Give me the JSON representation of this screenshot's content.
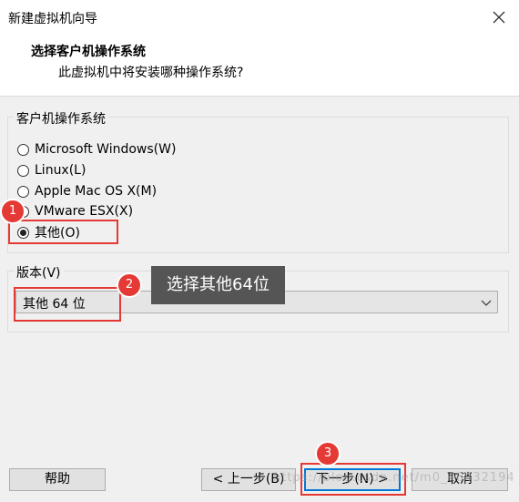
{
  "window": {
    "title": "新建虚拟机向导"
  },
  "header": {
    "title": "选择客户机操作系统",
    "subtitle": "此虚拟机中将安装哪种操作系统?"
  },
  "os_group": {
    "legend": "客户机操作系统",
    "options": [
      {
        "label": "Microsoft Windows(W)",
        "checked": false
      },
      {
        "label": "Linux(L)",
        "checked": false
      },
      {
        "label": "Apple Mac OS X(M)",
        "checked": false
      },
      {
        "label": "VMware ESX(X)",
        "checked": false
      },
      {
        "label": "其他(O)",
        "checked": true
      }
    ]
  },
  "version_group": {
    "legend": "版本(V)",
    "selected": "其他 64 位"
  },
  "annotations": {
    "badges": [
      "1",
      "2",
      "3"
    ],
    "callout": "选择其他64位",
    "highlight_color": "#e53935"
  },
  "buttons": {
    "help": "帮助",
    "back": "< 上一步(B)",
    "next": "下一步(N) >",
    "cancel": "取消"
  },
  "watermark": "https://blog.csdn.net/m0_46432194",
  "colors": {
    "accent": "#0078d7",
    "panel": "#f0f0f0"
  }
}
